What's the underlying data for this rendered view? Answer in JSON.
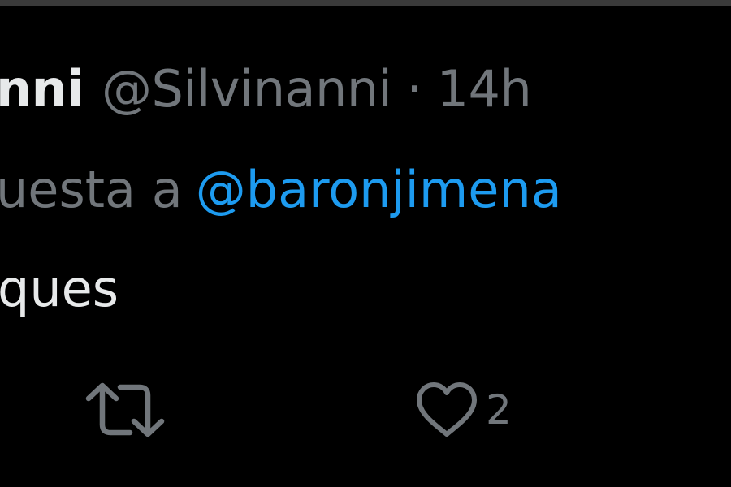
{
  "tweet": {
    "display_name": "nni",
    "handle": "@Silvinanni",
    "separator": "·",
    "timestamp": "14h",
    "reply_prefix": "uesta a",
    "reply_mention": "@baronjimena",
    "text": "ques",
    "actions": {
      "retweet_icon": "retweet-icon",
      "like_icon": "heart-icon",
      "like_count": "2"
    }
  },
  "colors": {
    "background": "#000000",
    "primary_text": "#e7e9ea",
    "secondary_text": "#71767b",
    "link": "#1d9bf0"
  }
}
